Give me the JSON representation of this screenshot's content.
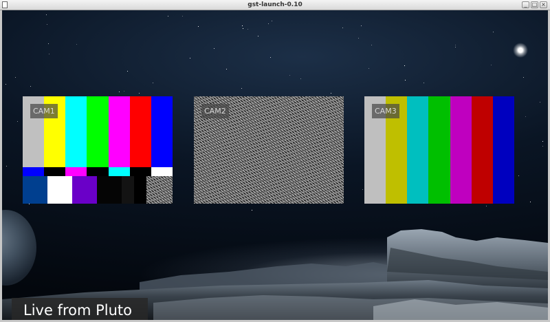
{
  "window": {
    "title": "gst-launch-0.10",
    "minimize_glyph": "_",
    "maximize_glyph": "□",
    "close_glyph": "×"
  },
  "cameras": [
    {
      "label": "CAM1",
      "source": "smpte-color-bars"
    },
    {
      "label": "CAM2",
      "source": "snow-noise"
    },
    {
      "label": "CAM3",
      "source": "smpte75-color-bars"
    }
  ],
  "caption": "Live from Pluto",
  "colors": {
    "smpte_top": [
      "#c0c0c0",
      "#ffff00",
      "#00ffff",
      "#00ff00",
      "#ff00ff",
      "#ff0000",
      "#0000ff"
    ],
    "smpte_mid": [
      "#0000ff",
      "#000000",
      "#ff00ff",
      "#000000",
      "#00ffff",
      "#000000",
      "#ffffff"
    ],
    "smpte_bottom": [
      "#003f8f",
      "#ffffff",
      "#6a00c8",
      "#050505",
      "#131313",
      "#000000"
    ],
    "smpte75": [
      "#bfbfbf",
      "#bfbf00",
      "#00bfbf",
      "#00bf00",
      "#bf00bf",
      "#bf0000",
      "#0000bf"
    ]
  },
  "icons": [
    "window-app-icon",
    "minimize-icon",
    "maximize-icon",
    "close-icon"
  ]
}
